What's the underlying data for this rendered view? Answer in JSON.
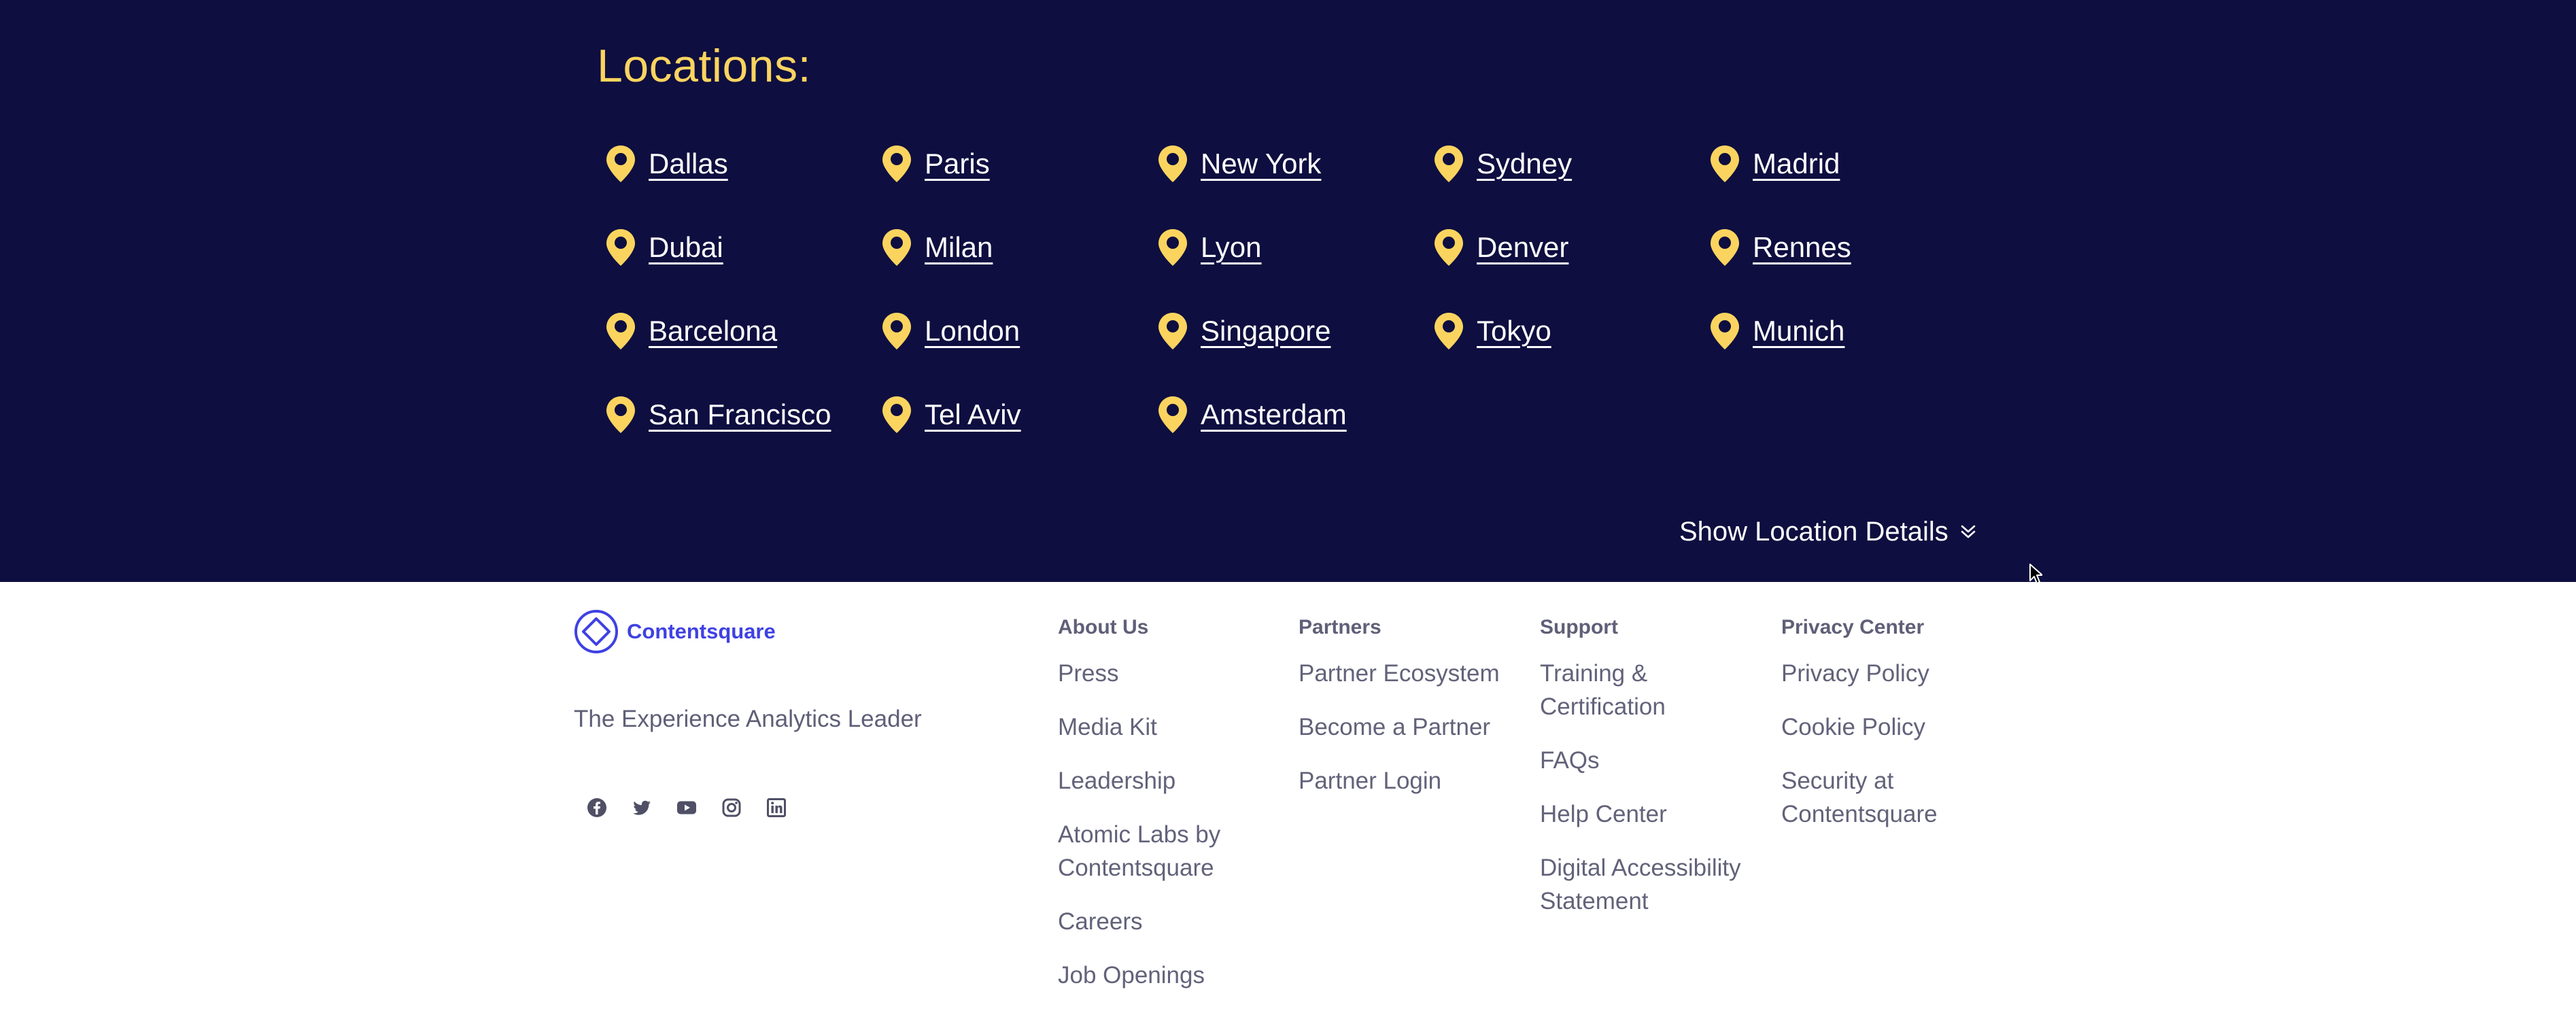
{
  "locations": {
    "title": "Locations:",
    "cities": [
      "Dallas",
      "Paris",
      "New York",
      "Sydney",
      "Madrid",
      "Dubai",
      "Milan",
      "Lyon",
      "Denver",
      "Rennes",
      "Barcelona",
      "London",
      "Singapore",
      "Tokyo",
      "Munich",
      "San Francisco",
      "Tel Aviv",
      "Amsterdam"
    ],
    "show_details_label": "Show Location Details",
    "pin_icon": "map-pin-icon",
    "accent_color": "#fbd45f",
    "background_color": "#0e0e40"
  },
  "footer": {
    "brand_name": "Contentsquare",
    "brand_color": "#3f41e3",
    "tagline": "The Experience Analytics Leader",
    "socials": [
      "facebook-icon",
      "twitter-icon",
      "youtube-icon",
      "instagram-icon",
      "linkedin-icon"
    ],
    "columns": [
      {
        "heading": "About Us",
        "links": [
          "Press",
          "Media Kit",
          "Leadership",
          "Atomic Labs by Contentsquare",
          "Careers",
          "Job Openings"
        ]
      },
      {
        "heading": "Partners",
        "links": [
          "Partner Ecosystem",
          "Become a Partner",
          "Partner Login"
        ]
      },
      {
        "heading": "Support",
        "links": [
          "Training & Certification",
          "FAQs",
          "Help Center",
          "Digital Accessibility Statement"
        ]
      },
      {
        "heading": "Privacy Center",
        "links": [
          "Privacy Policy",
          "Cookie Policy",
          "Security at Contentsquare"
        ]
      }
    ]
  }
}
